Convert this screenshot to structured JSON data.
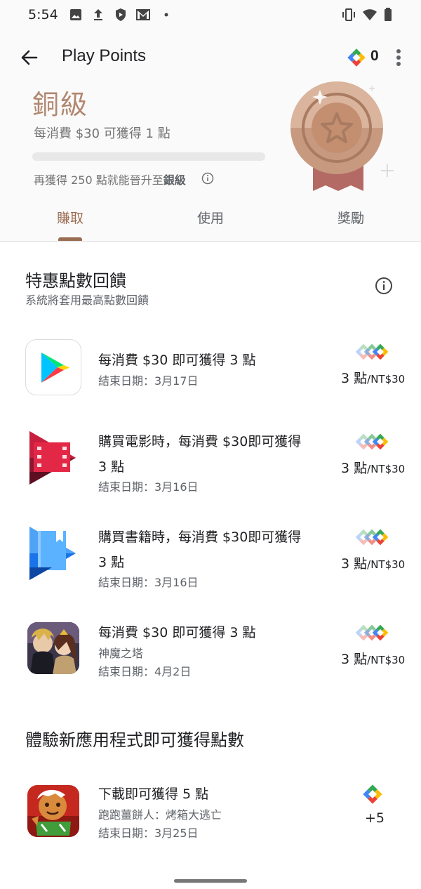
{
  "status_bar": {
    "time": "5:54",
    "left_icons": [
      "image-icon",
      "upload-icon",
      "shield-icon",
      "gmail-icon",
      "dot-icon"
    ],
    "right_icons": [
      "vibrate-icon",
      "wifi-icon",
      "battery-icon"
    ]
  },
  "app_bar": {
    "title": "Play Points",
    "points": "0"
  },
  "tier": {
    "name": "銅級",
    "rate": "每消費 $30 可獲得 1 點",
    "progress": 0,
    "upgrade_prefix": "再獲得 250 點就能晉升至",
    "upgrade_target": "銀級"
  },
  "tabs": [
    {
      "label": "賺取",
      "active": true
    },
    {
      "label": "使用",
      "active": false
    },
    {
      "label": "獎勵",
      "active": false
    }
  ],
  "section_offers": {
    "title": "特惠點數回饋",
    "subtitle": "系統將套用最高點數回饋"
  },
  "offers": [
    {
      "line1": "每消費 $30 即可獲得 3 點",
      "line2": "",
      "meta1": "結束日期：3月17日",
      "meta2": "",
      "rate": "3 點",
      "rate_unit": "/NT$30",
      "icon": "play-store-icon"
    },
    {
      "line1": "購買電影時，每消費 $30即可獲得",
      "line2": "3 點",
      "meta1": "結束日期：3月16日",
      "meta2": "",
      "rate": "3 點",
      "rate_unit": "/NT$30",
      "icon": "play-movies-icon"
    },
    {
      "line1": "購買書籍時，每消費 $30即可獲得",
      "line2": "3 點",
      "meta1": "結束日期：3月16日",
      "meta2": "",
      "rate": "3 點",
      "rate_unit": "/NT$30",
      "icon": "play-books-icon"
    },
    {
      "line1": "每消費 $30 即可獲得 3 點",
      "line2": "",
      "meta1": "神魔之塔",
      "meta2": "結束日期：4月2日",
      "rate": "3 點",
      "rate_unit": "/NT$30",
      "icon": "tower-of-saviors-icon"
    }
  ],
  "section_new_apps": {
    "title": "體驗新應用程式即可獲得點數"
  },
  "new_apps": [
    {
      "line1": "下載即可獲得 5 點",
      "meta1": "跑跑薑餅人：烤箱大逃亡",
      "meta2": "結束日期：3月25日",
      "reward": "+5",
      "icon": "cookie-run-icon"
    }
  ],
  "colors": {
    "bronze": "#b08871",
    "tab_active": "#996d52",
    "points_green": "#34a853",
    "points_yellow": "#fbbc04",
    "points_red": "#ea4335",
    "points_blue": "#4285f4"
  }
}
